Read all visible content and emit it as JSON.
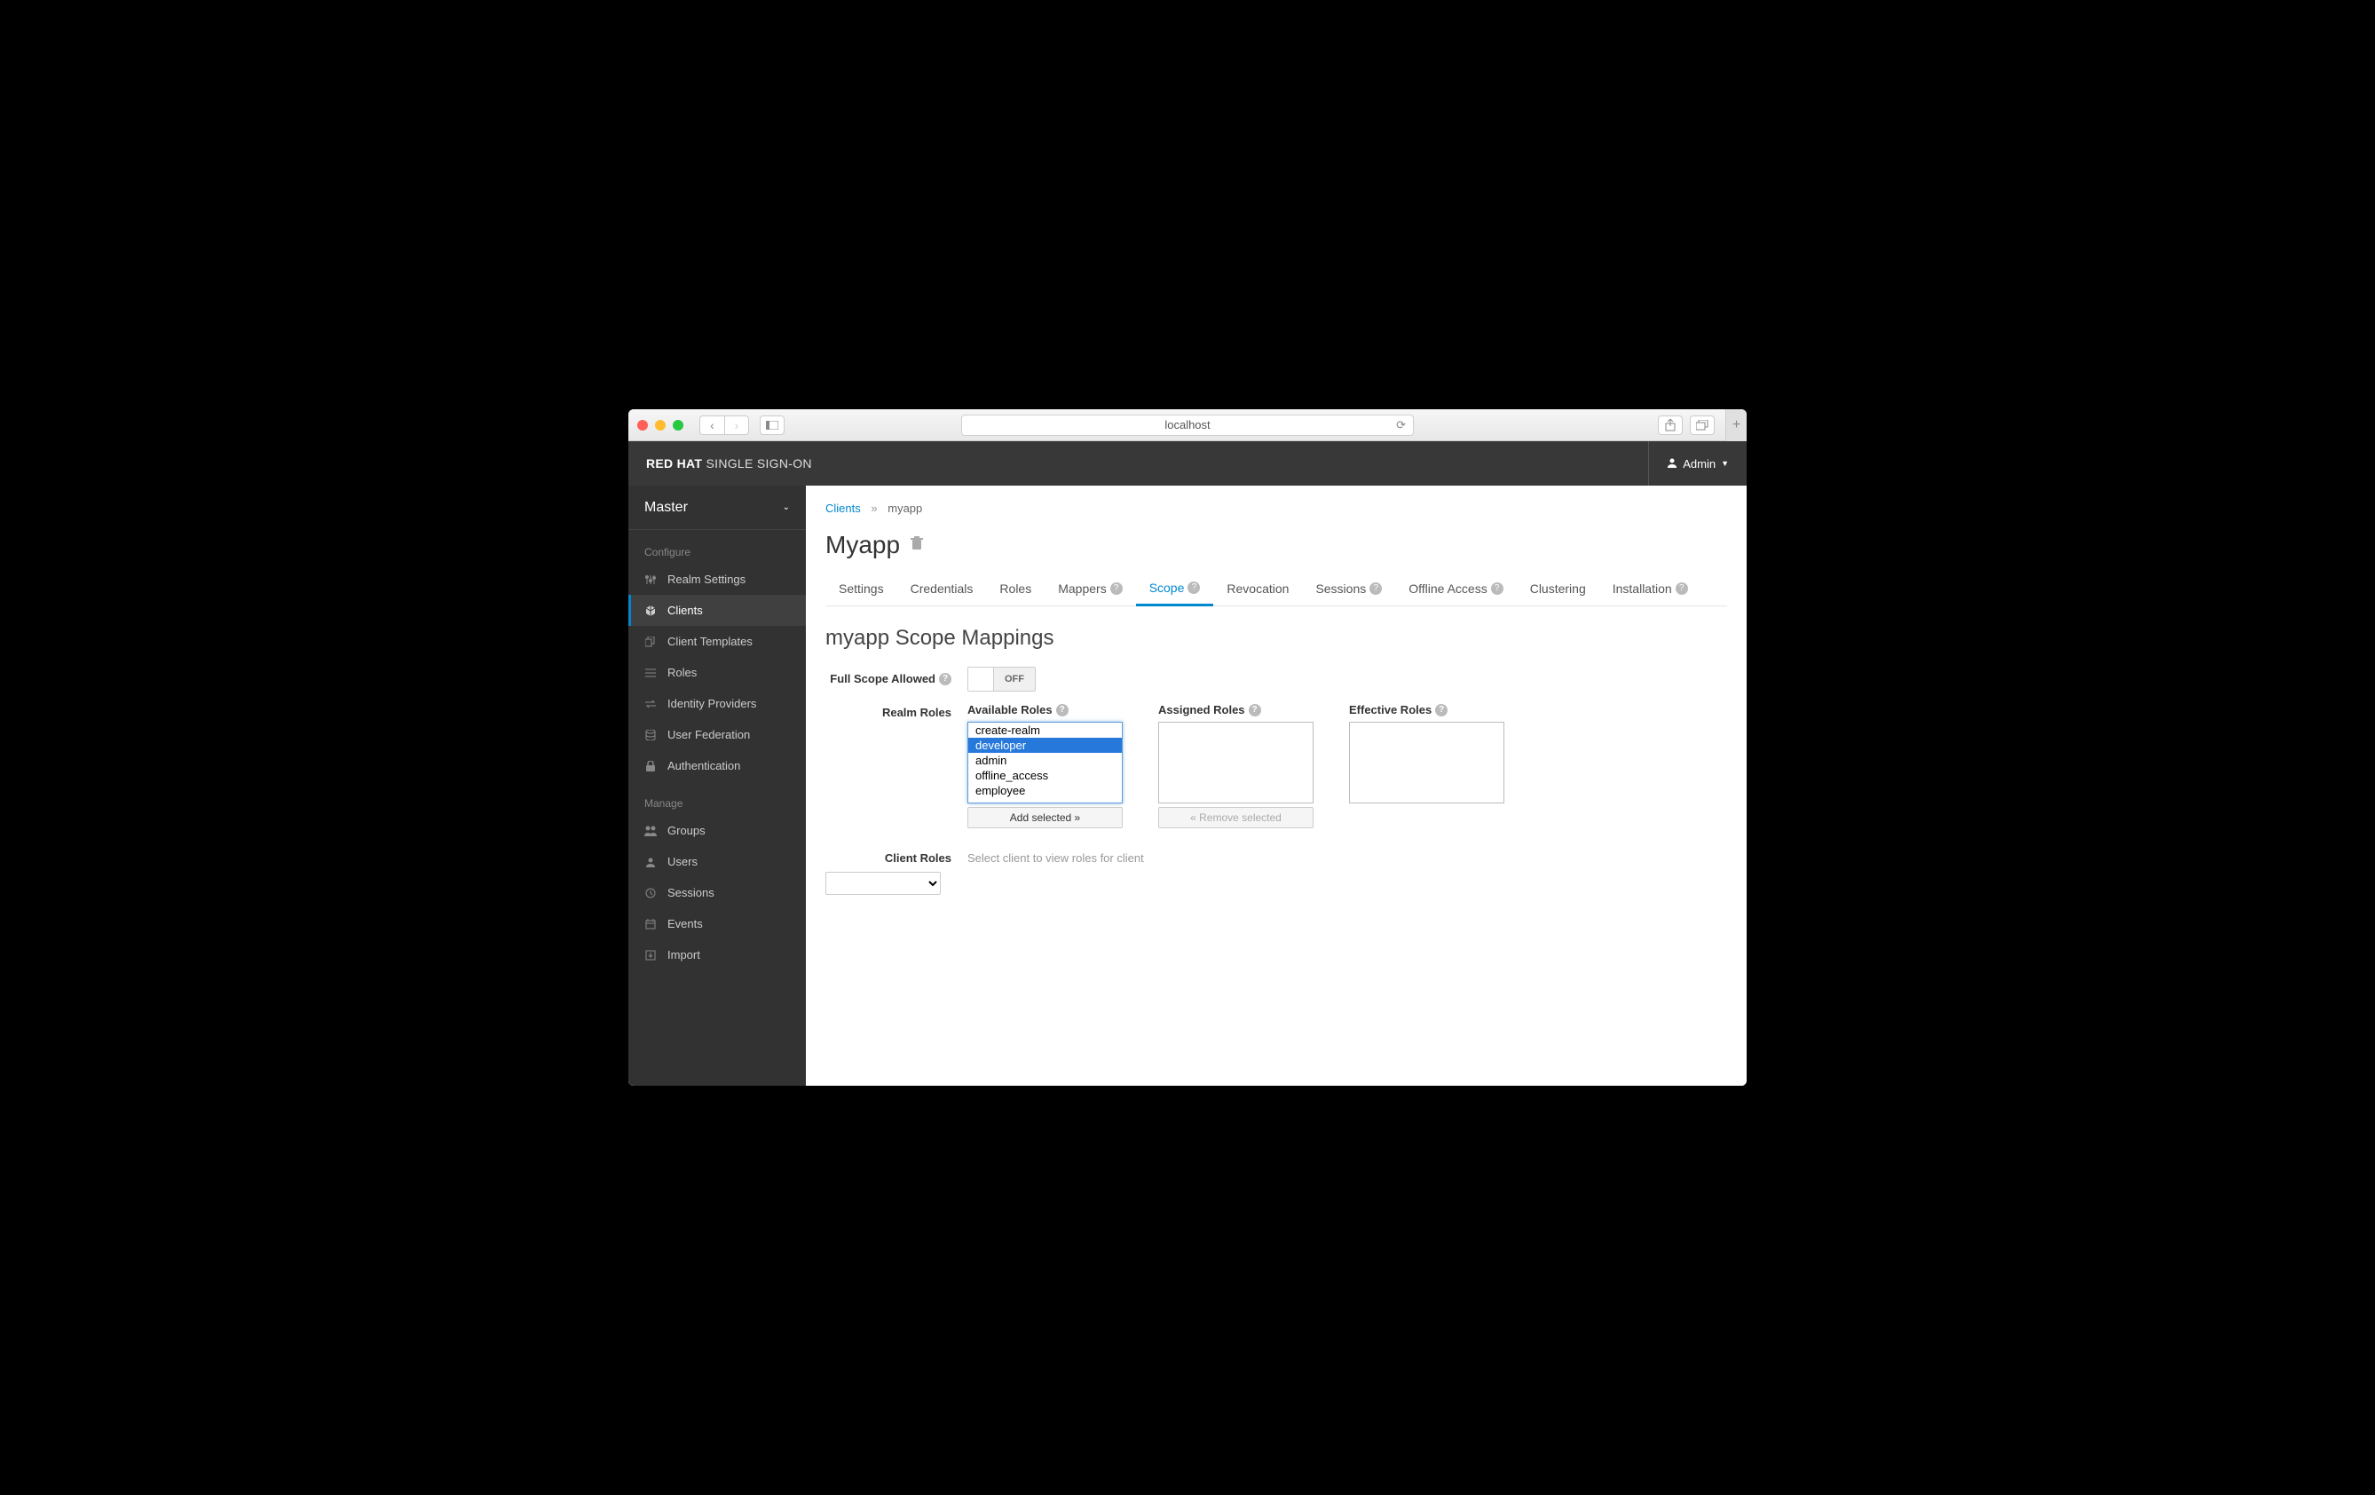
{
  "browser": {
    "url": "localhost"
  },
  "header": {
    "logo_bold": "RED HAT",
    "logo_light": "SINGLE SIGN-ON",
    "user": "Admin"
  },
  "sidebar": {
    "realm": "Master",
    "configure_label": "Configure",
    "manage_label": "Manage",
    "configure": [
      {
        "label": "Realm Settings",
        "icon": "sliders"
      },
      {
        "label": "Clients",
        "icon": "cube",
        "active": true
      },
      {
        "label": "Client Templates",
        "icon": "copy"
      },
      {
        "label": "Roles",
        "icon": "list"
      },
      {
        "label": "Identity Providers",
        "icon": "exchange"
      },
      {
        "label": "User Federation",
        "icon": "database"
      },
      {
        "label": "Authentication",
        "icon": "lock"
      }
    ],
    "manage": [
      {
        "label": "Groups",
        "icon": "users"
      },
      {
        "label": "Users",
        "icon": "user"
      },
      {
        "label": "Sessions",
        "icon": "clock"
      },
      {
        "label": "Events",
        "icon": "calendar"
      },
      {
        "label": "Import",
        "icon": "import"
      }
    ]
  },
  "breadcrumb": {
    "link": "Clients",
    "current": "myapp"
  },
  "page": {
    "title": "Myapp"
  },
  "tabs": [
    {
      "label": "Settings",
      "help": false
    },
    {
      "label": "Credentials",
      "help": false
    },
    {
      "label": "Roles",
      "help": false
    },
    {
      "label": "Mappers",
      "help": true
    },
    {
      "label": "Scope",
      "help": true,
      "active": true
    },
    {
      "label": "Revocation",
      "help": false
    },
    {
      "label": "Sessions",
      "help": true
    },
    {
      "label": "Offline Access",
      "help": true
    },
    {
      "label": "Clustering",
      "help": false
    },
    {
      "label": "Installation",
      "help": true
    }
  ],
  "scope": {
    "section_title": "myapp Scope Mappings",
    "full_scope_label": "Full Scope Allowed",
    "toggle_state": "OFF",
    "realm_roles_label": "Realm Roles",
    "client_roles_label": "Client Roles",
    "available_label": "Available Roles",
    "assigned_label": "Assigned Roles",
    "effective_label": "Effective Roles",
    "available_roles": [
      "create-realm",
      "developer",
      "admin",
      "offline_access",
      "employee"
    ],
    "selected_role": "developer",
    "add_button": "Add selected »",
    "remove_button": "« Remove selected",
    "client_hint": "Select client to view roles for client"
  }
}
